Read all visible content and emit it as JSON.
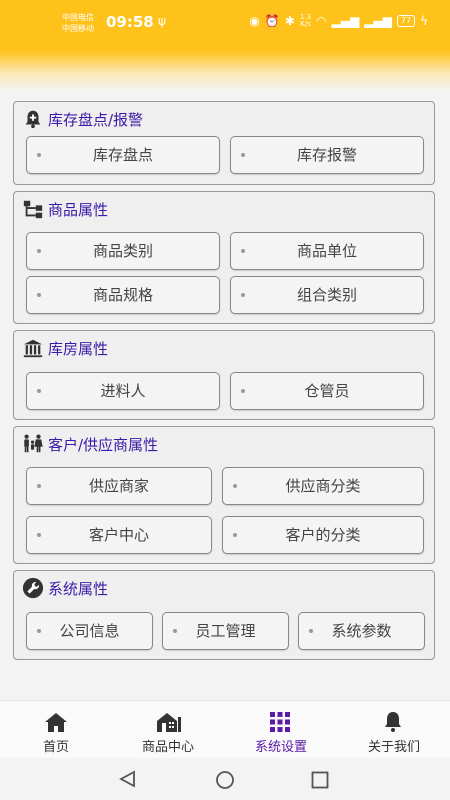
{
  "status_bar": {
    "carrier1": "中国电信",
    "carrier2": "中国移动",
    "time": "09:58",
    "net_speed_value": "1.3",
    "net_speed_unit": "K/s",
    "battery": "77"
  },
  "sections": {
    "inventory": {
      "title": "库存盘点/报警",
      "buttons": [
        "库存盘点",
        "库存报警"
      ]
    },
    "product": {
      "title": "商品属性",
      "buttons": [
        "商品类别",
        "商品单位",
        "商品规格",
        "组合类别"
      ]
    },
    "warehouse": {
      "title": "库房属性",
      "buttons": [
        "进料人",
        "仓管员"
      ]
    },
    "customer": {
      "title": "客户/供应商属性",
      "buttons": [
        "供应商家",
        "供应商分类",
        "客户中心",
        "客户的分类"
      ]
    },
    "system": {
      "title": "系统属性",
      "buttons": [
        "公司信息",
        "员工管理",
        "系统参数"
      ]
    }
  },
  "tabs": [
    {
      "label": "首页",
      "icon": "home-icon"
    },
    {
      "label": "商品中心",
      "icon": "store-icon"
    },
    {
      "label": "系统设置",
      "icon": "grid-icon"
    },
    {
      "label": "关于我们",
      "icon": "bell-icon"
    }
  ],
  "active_tab": "系统设置",
  "colors": {
    "header": "#ffc21a",
    "section_title": "#3a1aa8",
    "active_tab": "#5b1aa8"
  }
}
